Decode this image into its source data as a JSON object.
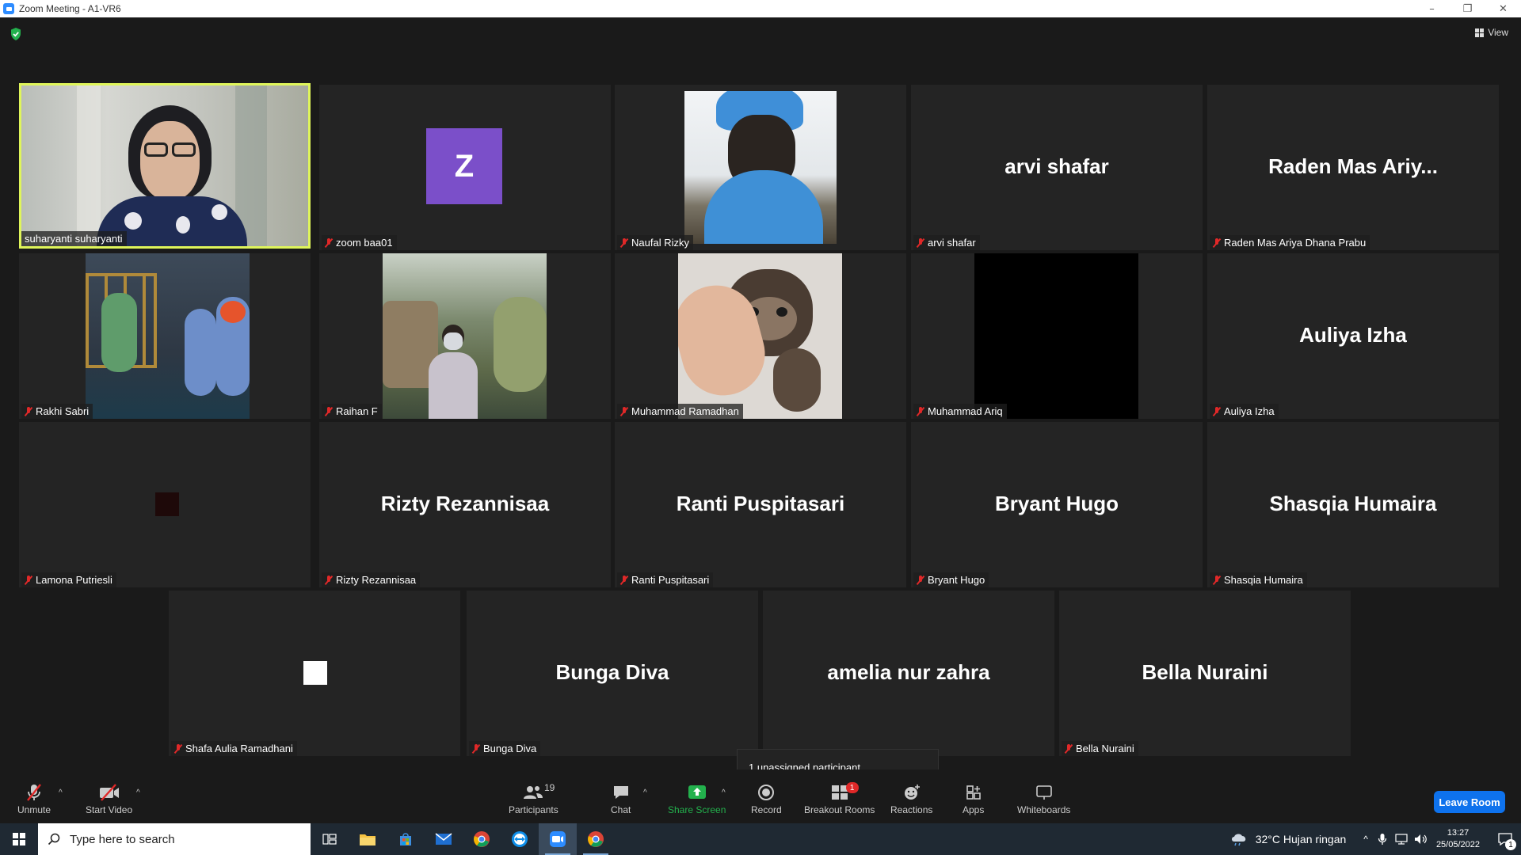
{
  "window": {
    "title": "Zoom Meeting - A1-VR6",
    "controls": [
      "–",
      "❐",
      "✕"
    ]
  },
  "header": {
    "view_label": "View"
  },
  "tiles": [
    {
      "name": "suharyanti suharyanti",
      "display": "",
      "muted": false
    },
    {
      "name": "zoom baa01",
      "display": "",
      "avatar_letter": "Z",
      "muted": true
    },
    {
      "name": "Naufal Rizky",
      "display": "",
      "muted": true
    },
    {
      "name": "arvi shafar",
      "display": "arvi shafar",
      "muted": true
    },
    {
      "name": "Raden Mas Ariya Dhana Prabu",
      "display": "Raden Mas Ariy...",
      "muted": true
    },
    {
      "name": "Rakhi Sabri",
      "display": "",
      "muted": true
    },
    {
      "name": "Raihan F",
      "display": "",
      "muted": true
    },
    {
      "name": "Muhammad Ramadhan",
      "display": "",
      "muted": true
    },
    {
      "name": "Muhammad Ariq",
      "display": "",
      "muted": true
    },
    {
      "name": "Auliya Izha",
      "display": "Auliya Izha",
      "muted": true
    },
    {
      "name": "Lamona Putriesli",
      "display": "",
      "muted": true
    },
    {
      "name": "Rizty Rezannisaa",
      "display": "Rizty Rezannisaa",
      "muted": true
    },
    {
      "name": "Ranti Puspitasari",
      "display": "Ranti Puspitasari",
      "muted": true
    },
    {
      "name": "Bryant Hugo",
      "display": "Bryant Hugo",
      "muted": true
    },
    {
      "name": "Shasqia Humaira",
      "display": "Shasqia Humaira",
      "muted": true
    },
    {
      "name": "Shafa Aulia Ramadhani",
      "display": "",
      "muted": true
    },
    {
      "name": "Bunga Diva",
      "display": "Bunga Diva",
      "muted": true
    },
    {
      "name": "amelia nur zahra",
      "display": "amelia nur zahra",
      "muted": true
    },
    {
      "name": "Bella Nuraini",
      "display": "Bella Nuraini",
      "muted": true
    }
  ],
  "tooltip": "1 unassigned participant",
  "toolbar": {
    "unmute": "Unmute",
    "start_video": "Start Video",
    "participants": "Participants",
    "participants_count": "19",
    "chat": "Chat",
    "share_screen": "Share Screen",
    "record": "Record",
    "breakout_rooms": "Breakout Rooms",
    "breakout_badge": "1",
    "reactions": "Reactions",
    "apps": "Apps",
    "whiteboards": "Whiteboards",
    "leave": "Leave Room"
  },
  "taskbar": {
    "search_placeholder": "Type here to search",
    "weather": "32°C  Hujan ringan",
    "time": "13:27",
    "date": "25/05/2022",
    "notification_count": "1"
  },
  "colors": {
    "accent_blue": "#0e72ed",
    "active_speaker": "#dff55a",
    "avatar_purple": "#7b4fc9",
    "share_green": "#23b14d"
  }
}
